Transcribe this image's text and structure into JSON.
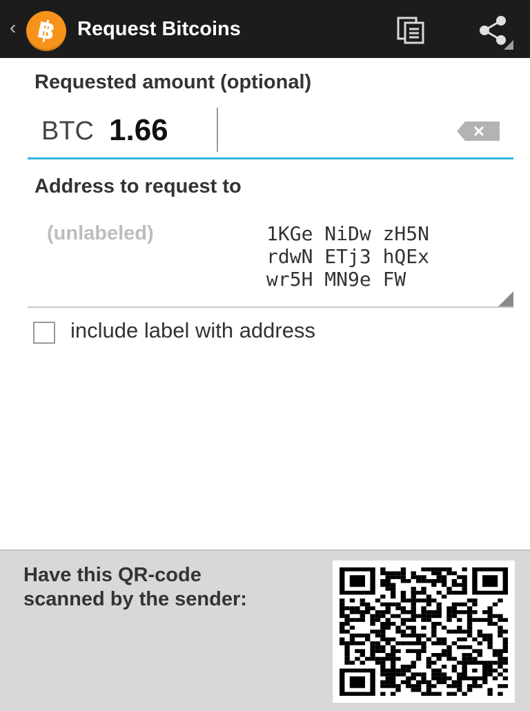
{
  "header": {
    "title": "Request Bitcoins",
    "back_icon": "back-chevron",
    "logo_icon": "bitcoin-logo",
    "logo_glyph": "฿",
    "actions": [
      "copy-icon",
      "share-icon"
    ]
  },
  "amount": {
    "label": "Requested amount (optional)",
    "currency": "BTC",
    "value": "1.66"
  },
  "address": {
    "label": "Address to request to",
    "address_label": "(unlabeled)",
    "lines": [
      "1KGe NiDw zH5N",
      "rdwN ETj3 hQEx",
      "wr5H MN9e FW"
    ]
  },
  "include_label": {
    "text": "include label with address",
    "checked": false
  },
  "qr": {
    "instruction_line1": "Have this QR-code",
    "instruction_line2": "scanned by the sender:"
  },
  "colors": {
    "actionbar": "#1c1c1c",
    "accent": "#33b5e5",
    "bitcoin": "#f7931a",
    "panel": "#d8d8d8"
  }
}
